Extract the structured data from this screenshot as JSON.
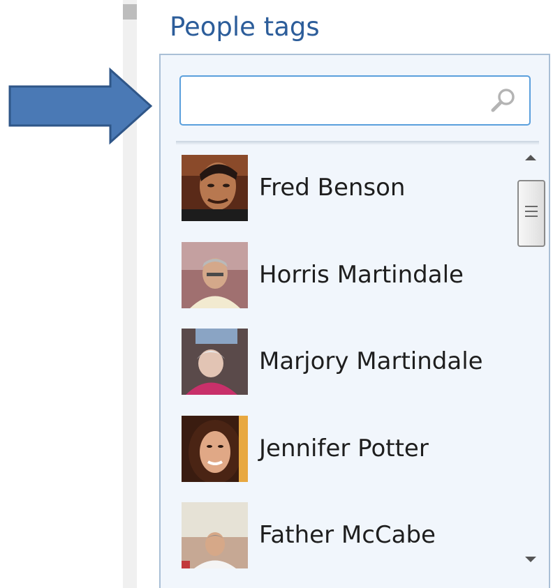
{
  "panel": {
    "title": "People tags"
  },
  "search": {
    "value": "",
    "placeholder": "",
    "icon": "magnifier-icon"
  },
  "people": [
    {
      "name": "Fred Benson"
    },
    {
      "name": "Horris Martindale"
    },
    {
      "name": "Marjory Martindale"
    },
    {
      "name": "Jennifer Potter"
    },
    {
      "name": "Father McCabe"
    }
  ],
  "colors": {
    "title": "#2c5d9a",
    "panel_bg": "#f1f6fc",
    "panel_border": "#a9bfd6",
    "search_border": "#5a9fdc",
    "arrow_fill": "#4a79b5",
    "arrow_stroke": "#2f5688"
  }
}
